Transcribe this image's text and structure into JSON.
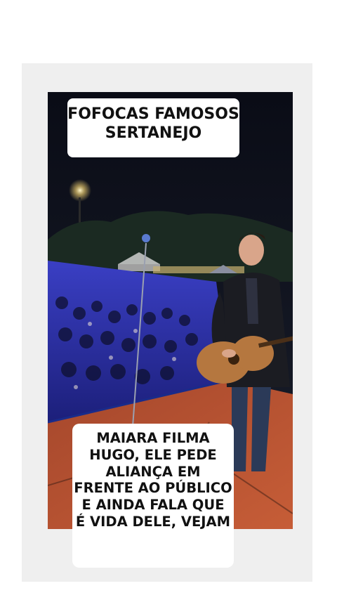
{
  "top_caption": {
    "line1": "FOFOCAS FAMOSOS",
    "line2": "SERTANEJO"
  },
  "bottom_caption": {
    "lines": [
      "MAIARA FILMA",
      "HUGO, ELE PEDE",
      "ALIANÇA EM",
      "FRENTE AO PÚBLICO",
      "E AINDA FALA QUE",
      "É VIDA DELE, VEJAM"
    ]
  }
}
